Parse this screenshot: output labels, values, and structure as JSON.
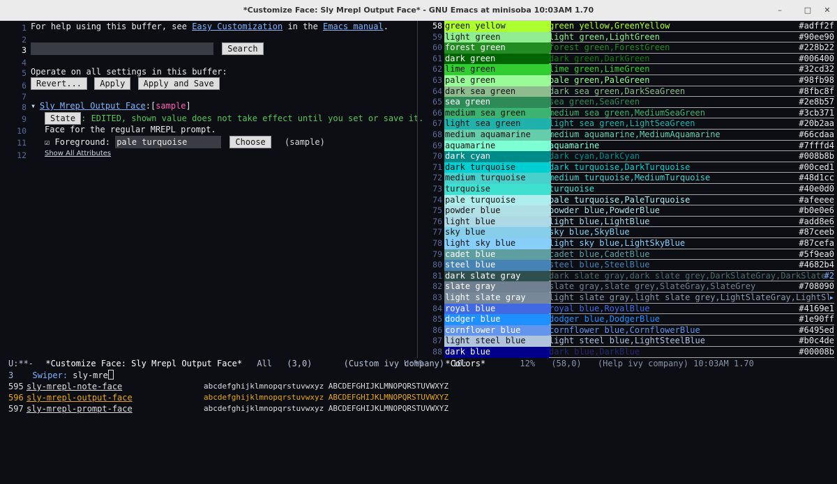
{
  "window": {
    "title": "*Customize Face: Sly Mrepl Output Face* - GNU Emacs at minisoba 10:03AM 1.70",
    "minimize_glyph": "–",
    "maximize_glyph": "□",
    "close_glyph": "✕"
  },
  "left_pane": {
    "line_numbers": [
      "1",
      "2",
      "3",
      "4",
      "5",
      "6",
      "7",
      "8",
      "9",
      "10",
      "11",
      "12"
    ],
    "help_prefix": "For help using this buffer, see ",
    "help_link1": "Easy Customization",
    "help_mid": " in the ",
    "help_link2": "Emacs manual",
    "help_suffix": ".",
    "search_button": "Search",
    "operate_text": "Operate on all settings in this buffer:",
    "revert_button": "Revert...",
    "apply_button": "Apply",
    "apply_save_button": "Apply and Save",
    "face_arrow": "▾",
    "face_name": "Sly Mrepl Output Face",
    "face_colon": ":[",
    "face_sample": "sample",
    "face_close": "]",
    "state_button": "State",
    "state_text": ": EDITED, shown value does not take effect until you set or save it.",
    "face_doc": "Face for the regular MREPL prompt.",
    "checkbox_glyph": "☑",
    "foreground_label": "Foreground:",
    "foreground_value": "pale turquoise",
    "choose_button": "Choose",
    "sample_paren": "(sample)",
    "show_all": "Show All Attributes"
  },
  "colors": [
    {
      "n": "58",
      "name": "green yellow",
      "desc": "green yellow,GreenYellow",
      "hex": "#adff2f",
      "bg": "#adff2f",
      "fg": "#111111",
      "dfg": "#adff2f"
    },
    {
      "n": "59",
      "name": "light green",
      "desc": "light green,LightGreen",
      "hex": "#90ee90",
      "bg": "#90ee90",
      "fg": "#111111",
      "dfg": "#90ee90"
    },
    {
      "n": "60",
      "name": "forest green",
      "desc": "forest green,ForestGreen",
      "hex": "#228b22",
      "bg": "#228b22",
      "fg": "#ffffff",
      "dfg": "#228b22"
    },
    {
      "n": "61",
      "name": "dark green",
      "desc": "dark green,DarkGreen",
      "hex": "#006400",
      "bg": "#006400",
      "fg": "#ffffff",
      "dfg": "#0c7a0c"
    },
    {
      "n": "62",
      "name": "lime green",
      "desc": "lime green,LimeGreen",
      "hex": "#32cd32",
      "bg": "#32cd32",
      "fg": "#111111",
      "dfg": "#32cd32"
    },
    {
      "n": "63",
      "name": "pale green",
      "desc": "pale green,PaleGreen",
      "hex": "#98fb98",
      "bg": "#98fb98",
      "fg": "#111111",
      "dfg": "#98fb98"
    },
    {
      "n": "64",
      "name": "dark sea green",
      "desc": "dark sea green,DarkSeaGreen",
      "hex": "#8fbc8f",
      "bg": "#8fbc8f",
      "fg": "#111111",
      "dfg": "#8fbc8f"
    },
    {
      "n": "65",
      "name": "sea green",
      "desc": "sea green,SeaGreen",
      "hex": "#2e8b57",
      "bg": "#2e8b57",
      "fg": "#ffffff",
      "dfg": "#2e8b57"
    },
    {
      "n": "66",
      "name": "medium sea green",
      "desc": "medium sea green,MediumSeaGreen",
      "hex": "#3cb371",
      "bg": "#3cb371",
      "fg": "#111111",
      "dfg": "#3cb371"
    },
    {
      "n": "67",
      "name": "light sea green",
      "desc": "light sea green,LightSeaGreen",
      "hex": "#20b2aa",
      "bg": "#20b2aa",
      "fg": "#111111",
      "dfg": "#20b2aa"
    },
    {
      "n": "68",
      "name": "medium aquamarine",
      "desc": "medium aquamarine,MediumAquamarine",
      "hex": "#66cdaa",
      "bg": "#66cdaa",
      "fg": "#111111",
      "dfg": "#66cdaa"
    },
    {
      "n": "69",
      "name": "aquamarine",
      "desc": "aquamarine",
      "hex": "#7fffd4",
      "bg": "#7fffd4",
      "fg": "#111111",
      "dfg": "#7fffd4"
    },
    {
      "n": "70",
      "name": "dark cyan",
      "desc": "dark cyan,DarkCyan",
      "hex": "#008b8b",
      "bg": "#008b8b",
      "fg": "#ffffff",
      "dfg": "#008b8b"
    },
    {
      "n": "71",
      "name": "dark turquoise",
      "desc": "dark turquoise,DarkTurquoise",
      "hex": "#00ced1",
      "bg": "#00ced1",
      "fg": "#111111",
      "dfg": "#00ced1"
    },
    {
      "n": "72",
      "name": "medium turquoise",
      "desc": "medium turquoise,MediumTurquoise",
      "hex": "#48d1cc",
      "bg": "#48d1cc",
      "fg": "#111111",
      "dfg": "#48d1cc"
    },
    {
      "n": "73",
      "name": "turquoise",
      "desc": "turquoise",
      "hex": "#40e0d0",
      "bg": "#40e0d0",
      "fg": "#111111",
      "dfg": "#40e0d0"
    },
    {
      "n": "74",
      "name": "pale turquoise",
      "desc": "pale turquoise,PaleTurquoise",
      "hex": "#afeeee",
      "bg": "#afeeee",
      "fg": "#111111",
      "dfg": "#afeeee"
    },
    {
      "n": "75",
      "name": "powder blue",
      "desc": "powder blue,PowderBlue",
      "hex": "#b0e0e6",
      "bg": "#b0e0e6",
      "fg": "#111111",
      "dfg": "#b0e0e6"
    },
    {
      "n": "76",
      "name": "light blue",
      "desc": "light blue,LightBlue",
      "hex": "#add8e6",
      "bg": "#add8e6",
      "fg": "#111111",
      "dfg": "#add8e6"
    },
    {
      "n": "77",
      "name": "sky blue",
      "desc": "sky blue,SkyBlue",
      "hex": "#87ceeb",
      "bg": "#87ceeb",
      "fg": "#111111",
      "dfg": "#87ceeb"
    },
    {
      "n": "78",
      "name": "light sky blue",
      "desc": "light sky blue,LightSkyBlue",
      "hex": "#87cefa",
      "bg": "#87cefa",
      "fg": "#111111",
      "dfg": "#87cefa"
    },
    {
      "n": "79",
      "name": "cadet blue",
      "desc": "cadet blue,CadetBlue",
      "hex": "#5f9ea0",
      "bg": "#5f9ea0",
      "fg": "#ffffff",
      "dfg": "#5f9ea0"
    },
    {
      "n": "80",
      "name": "steel blue",
      "desc": "steel blue,SteelBlue",
      "hex": "#4682b4",
      "bg": "#4682b4",
      "fg": "#ffffff",
      "dfg": "#4682b4"
    },
    {
      "n": "81",
      "name": "dark slate gray",
      "desc": "dark slate gray,dark slate grey,DarkSlateGray,DarkSlateGrey",
      "hex": "#2f4f4f",
      "bg": "#2f4f4f",
      "fg": "#ffffff",
      "dfg": "#4a6a6a",
      "over": "#2"
    },
    {
      "n": "82",
      "name": "slate gray",
      "desc": "slate gray,slate grey,SlateGray,SlateGrey",
      "hex": "#708090",
      "bg": "#708090",
      "fg": "#ffffff",
      "dfg": "#708090"
    },
    {
      "n": "83",
      "name": "light slate gray",
      "desc": "light slate gray,light slate grey,LightSlateGray,LightSlateGr",
      "hex": "",
      "bg": "#778899",
      "fg": "#ffffff",
      "dfg": "#8899aa",
      "over": "▸"
    },
    {
      "n": "84",
      "name": "royal blue",
      "desc": "royal blue,RoyalBlue",
      "hex": "#4169e1",
      "bg": "#4169e1",
      "fg": "#ffffff",
      "dfg": "#4169e1"
    },
    {
      "n": "85",
      "name": "dodger blue",
      "desc": "dodger blue,DodgerBlue",
      "hex": "#1e90ff",
      "bg": "#1e90ff",
      "fg": "#ffffff",
      "dfg": "#1e90ff"
    },
    {
      "n": "86",
      "name": "cornflower blue",
      "desc": "cornflower blue,CornflowerBlue",
      "hex": "#6495ed",
      "bg": "#6495ed",
      "fg": "#ffffff",
      "dfg": "#6495ed"
    },
    {
      "n": "87",
      "name": "light steel blue",
      "desc": "light steel blue,LightSteelBlue",
      "hex": "#b0c4de",
      "bg": "#b0c4de",
      "fg": "#111111",
      "dfg": "#b0c4de"
    },
    {
      "n": "88",
      "name": "dark blue",
      "desc": "dark blue,DarkBlue",
      "hex": "#00008b",
      "bg": "#00008b",
      "fg": "#ffffff",
      "dfg": "#25256a"
    }
  ],
  "modeline": {
    "left_status": "U:**-",
    "left_buffer": "*Customize Face: Sly Mrepl Output Face*",
    "left_pos": "All",
    "left_coords": "(3,0)",
    "left_modes": "(Custom ivy company)",
    "left_extra": "10:",
    "right_status": "U:%%-",
    "right_buffer": "*Colors*",
    "right_pos": "12%",
    "right_coords": "(58,0)",
    "right_modes": "(Help ivy company) 10:03AM 1.70"
  },
  "minibuffer": {
    "count": "3",
    "prompt": "Swiper:",
    "input": "sly-mre",
    "candidates": [
      {
        "n": "595",
        "name": "sly-mrepl-note-face",
        "sample": "abcdefghijklmnopqrstuvwxyz ABCDEFGHIJKLMNOPQRSTUVWXYZ",
        "color": "#dddddd",
        "selected": false
      },
      {
        "n": "596",
        "name": "sly-mrepl-output-face",
        "sample": "abcdefghijklmnopqrstuvwxyz ABCDEFGHIJKLMNOPQRSTUVWXYZ",
        "color": "#e6a817",
        "selected": true
      },
      {
        "n": "597",
        "name": "sly-mrepl-prompt-face",
        "sample": "abcdefghijklmnopqrstuvwxyz ABCDEFGHIJKLMNOPQRSTUVWXYZ",
        "color": "#dddddd",
        "selected": false
      }
    ]
  }
}
